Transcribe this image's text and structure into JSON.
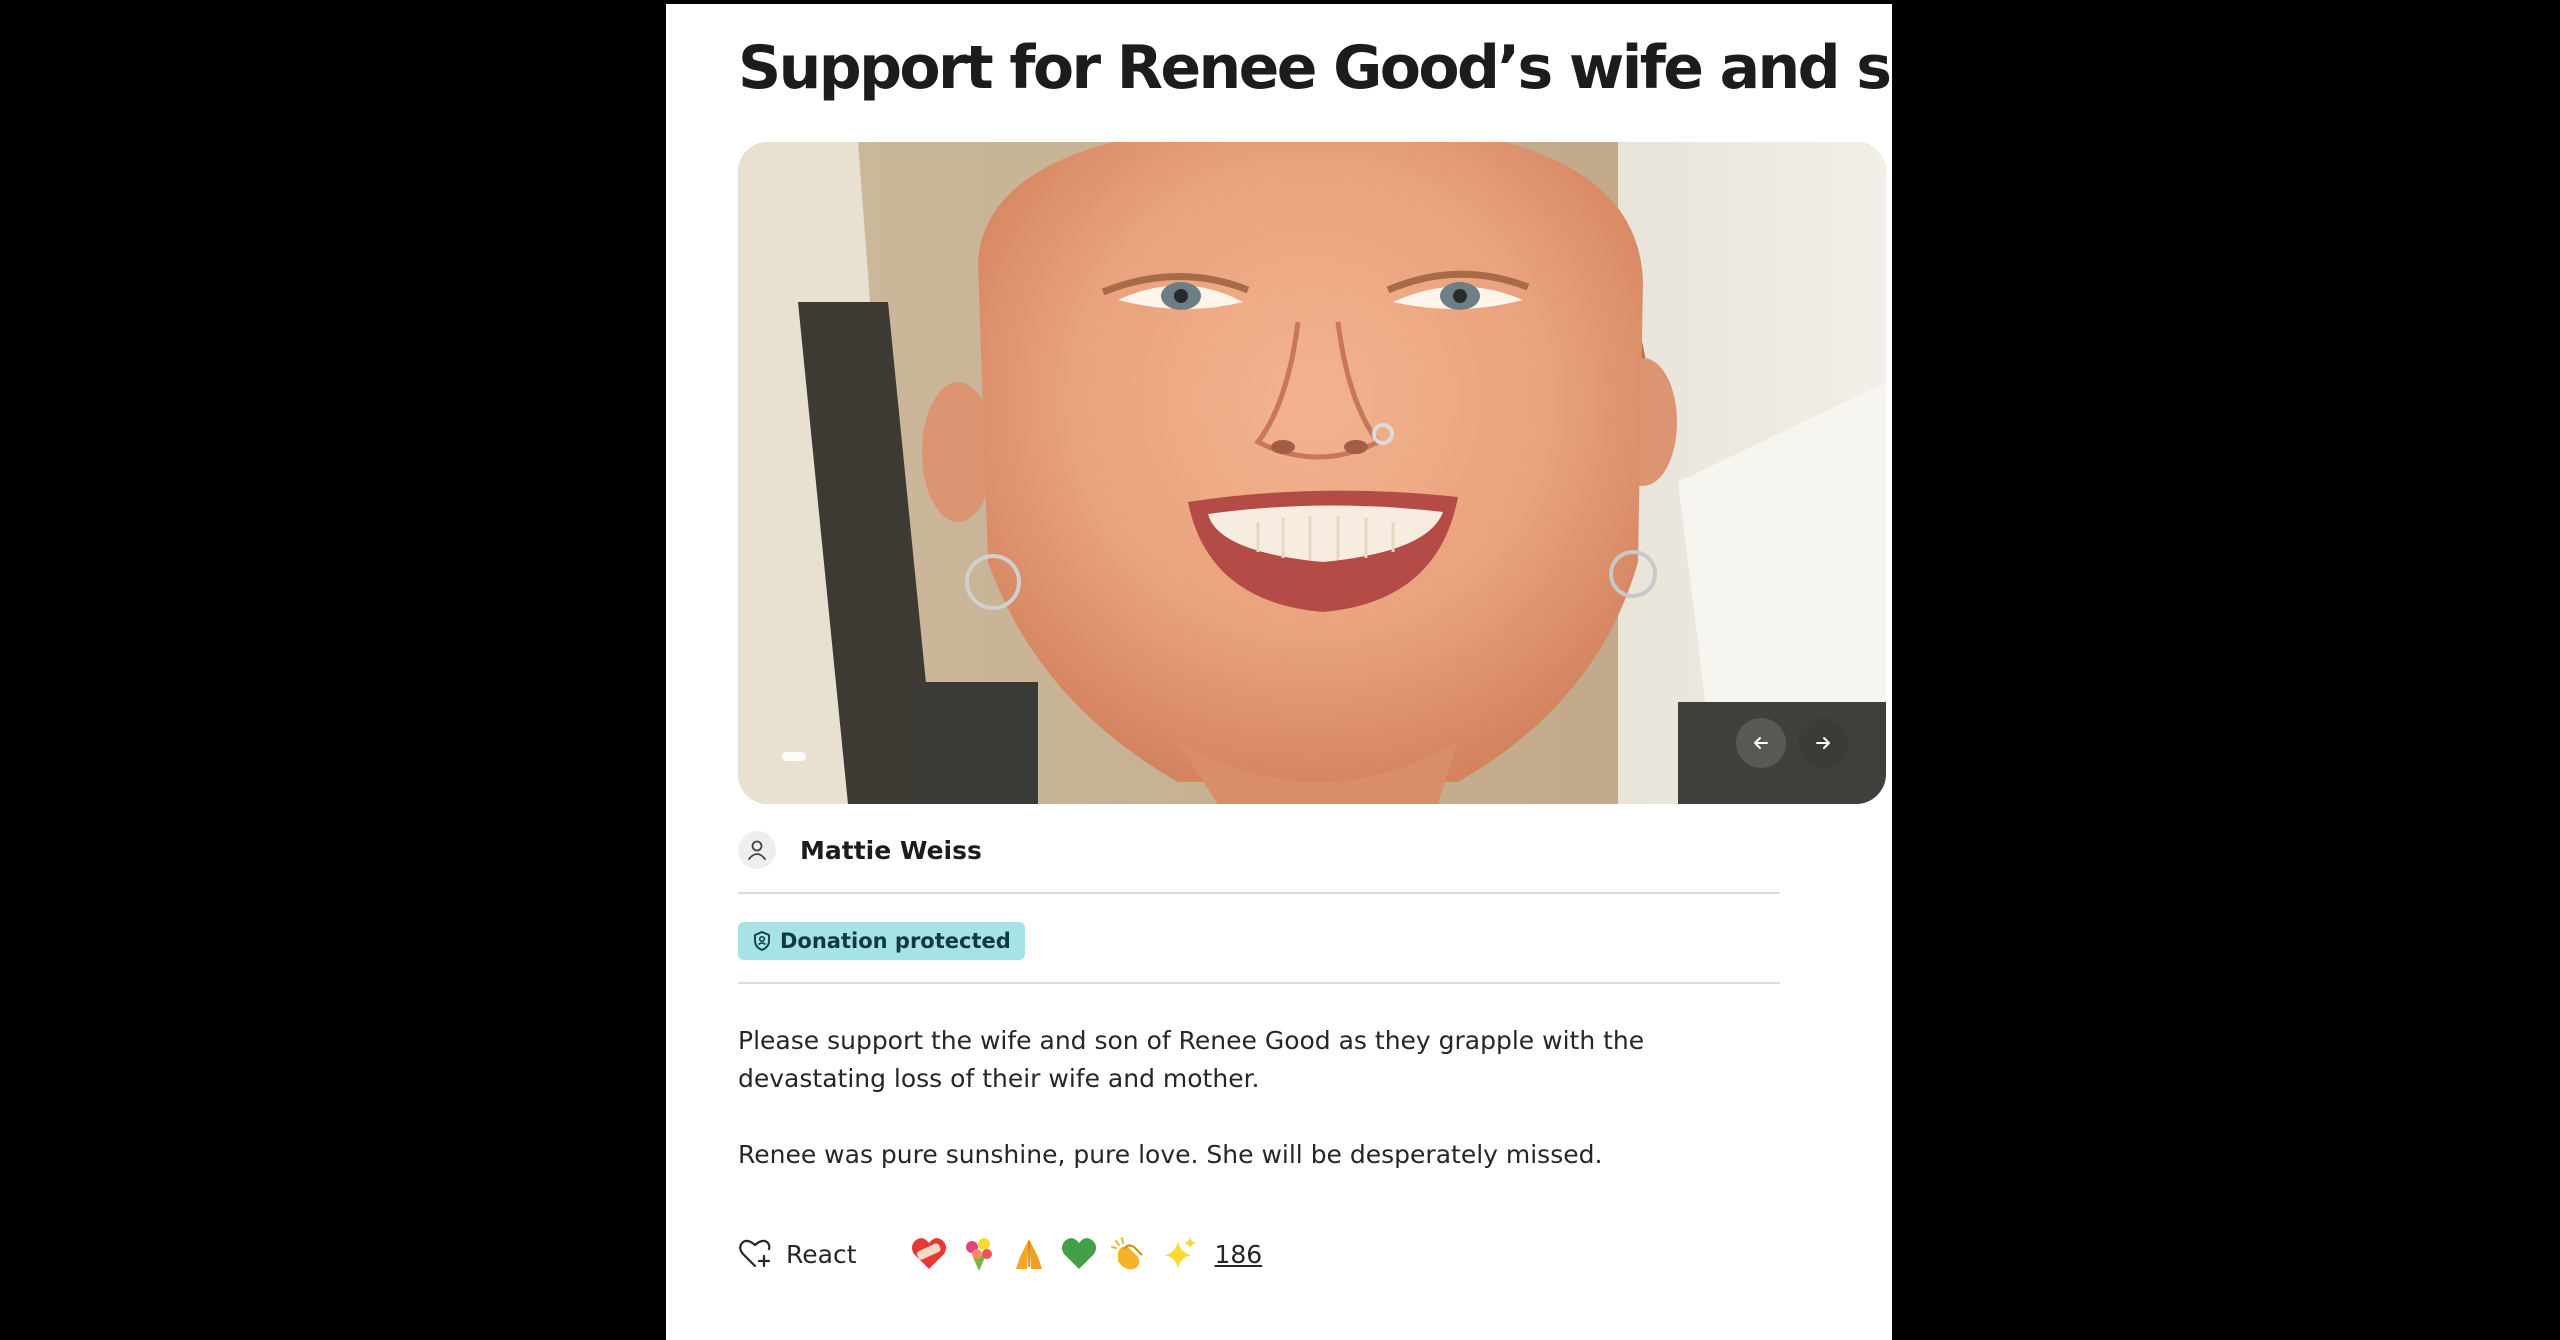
{
  "campaign": {
    "title": "Support for Renee Good’s wife and son",
    "hero_image_alt": "Photo of a smiling woman",
    "organizer_name": "Mattie Weiss",
    "badge_label": "Donation protected",
    "description": [
      "Please support the wife and son of Renee Good as they grapple with the devastating loss of their wife and mother.",
      "Renee was pure sunshine, pure love. She will be desperately missed."
    ]
  },
  "carousel": {
    "prev_icon": "arrow-left-icon",
    "next_icon": "arrow-right-icon"
  },
  "reactions": {
    "react_label": "React",
    "react_icon": "heart-plus-icon",
    "emojis": [
      "heart-with-bandage-emoji",
      "bouquet-emoji",
      "folded-hands-emoji",
      "green-heart-emoji",
      "clapping-hands-emoji",
      "sparkles-emoji"
    ],
    "count": "186"
  },
  "colors": {
    "badge_background": "#a6e3e6",
    "title_text": "#1c1c1c",
    "page_background": "#ffffff",
    "outer_background": "#000000"
  }
}
